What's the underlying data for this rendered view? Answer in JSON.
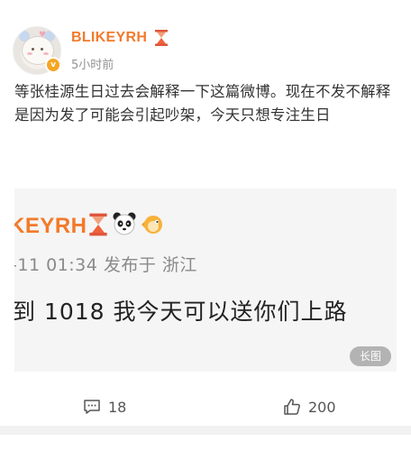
{
  "post": {
    "username": "BLIKEYRH",
    "timestamp": "5小时前",
    "text": "等张桂源生日过去会解释一下这篇微博。现在不发不解释是因为发了可能会引起吵架，今天只想专注生日",
    "verified_badge": "v",
    "embed": {
      "username": "KEYRH",
      "meta": "-11 01:34  发布于 浙江",
      "text": "到 1018 我今天可以送你们上路",
      "long_image_label": "长图"
    },
    "actions": {
      "comments": "18",
      "likes": "200"
    },
    "colors": {
      "username": "#f27a2b",
      "badge": "#f5a623"
    }
  }
}
